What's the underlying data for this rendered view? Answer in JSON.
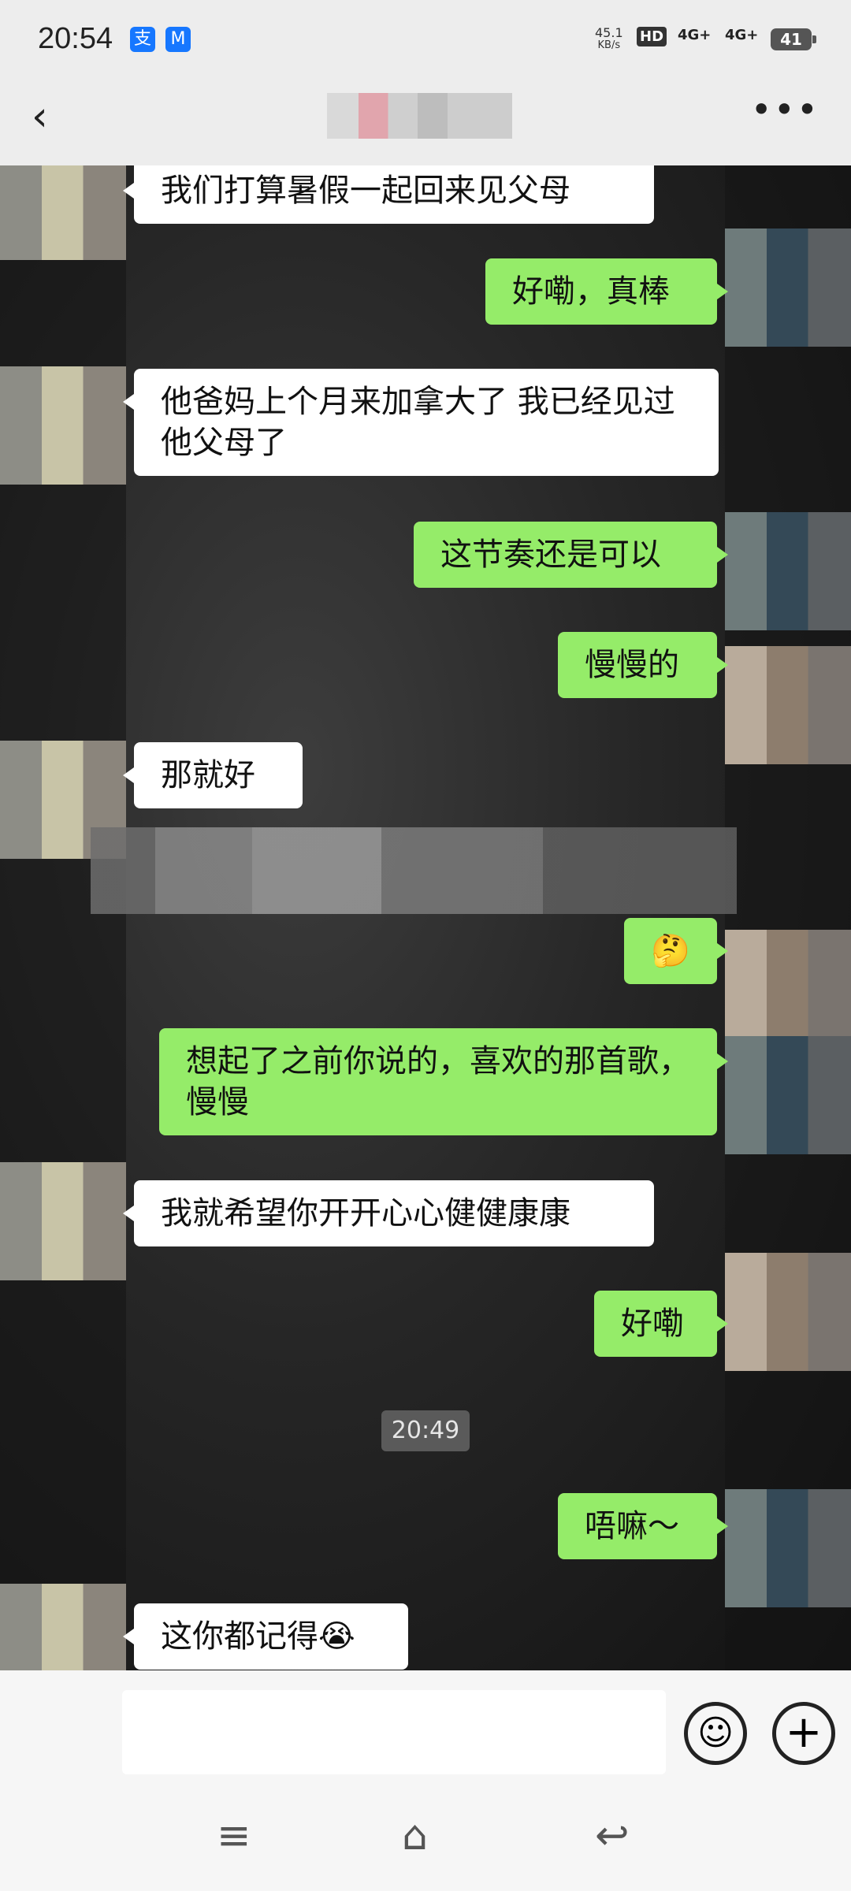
{
  "status_bar": {
    "time": "20:54",
    "app_icons": [
      "支",
      "M"
    ],
    "net_speed_value": "45.1",
    "net_speed_unit": "KB/s",
    "hd_label": "HD",
    "signal1": "4G+",
    "signal2": "4G+",
    "battery": "41"
  },
  "header": {
    "back_icon": "‹",
    "more_icon": "•••"
  },
  "messages": [
    {
      "side": "in",
      "text": "我们打算暑假一起回来见父母"
    },
    {
      "side": "out",
      "text": "好嘞，真棒"
    },
    {
      "side": "in",
      "text": "他爸妈上个月来加拿大了 我已经见过他父母了"
    },
    {
      "side": "out",
      "text": "这节奏还是可以"
    },
    {
      "side": "out",
      "text": "慢慢的"
    },
    {
      "side": "in",
      "text": "那就好"
    },
    {
      "side": "out",
      "text": "🤔"
    },
    {
      "side": "out",
      "text": "想起了之前你说的，喜欢的那首歌，慢慢"
    },
    {
      "side": "in",
      "text": "我就希望你开开心心健健康康"
    },
    {
      "side": "out",
      "text": "好嘞"
    },
    {
      "side": "out",
      "text": "唔嘛～"
    },
    {
      "side": "in",
      "text": "这你都记得😭"
    }
  ],
  "timestamp": "20:49",
  "input_bar": {
    "placeholder": "",
    "emoji_icon": "☺",
    "plus_icon": "+"
  },
  "nav_bar": {
    "menu_icon": "≡",
    "home_icon": "⌂",
    "back_icon": "↩"
  }
}
